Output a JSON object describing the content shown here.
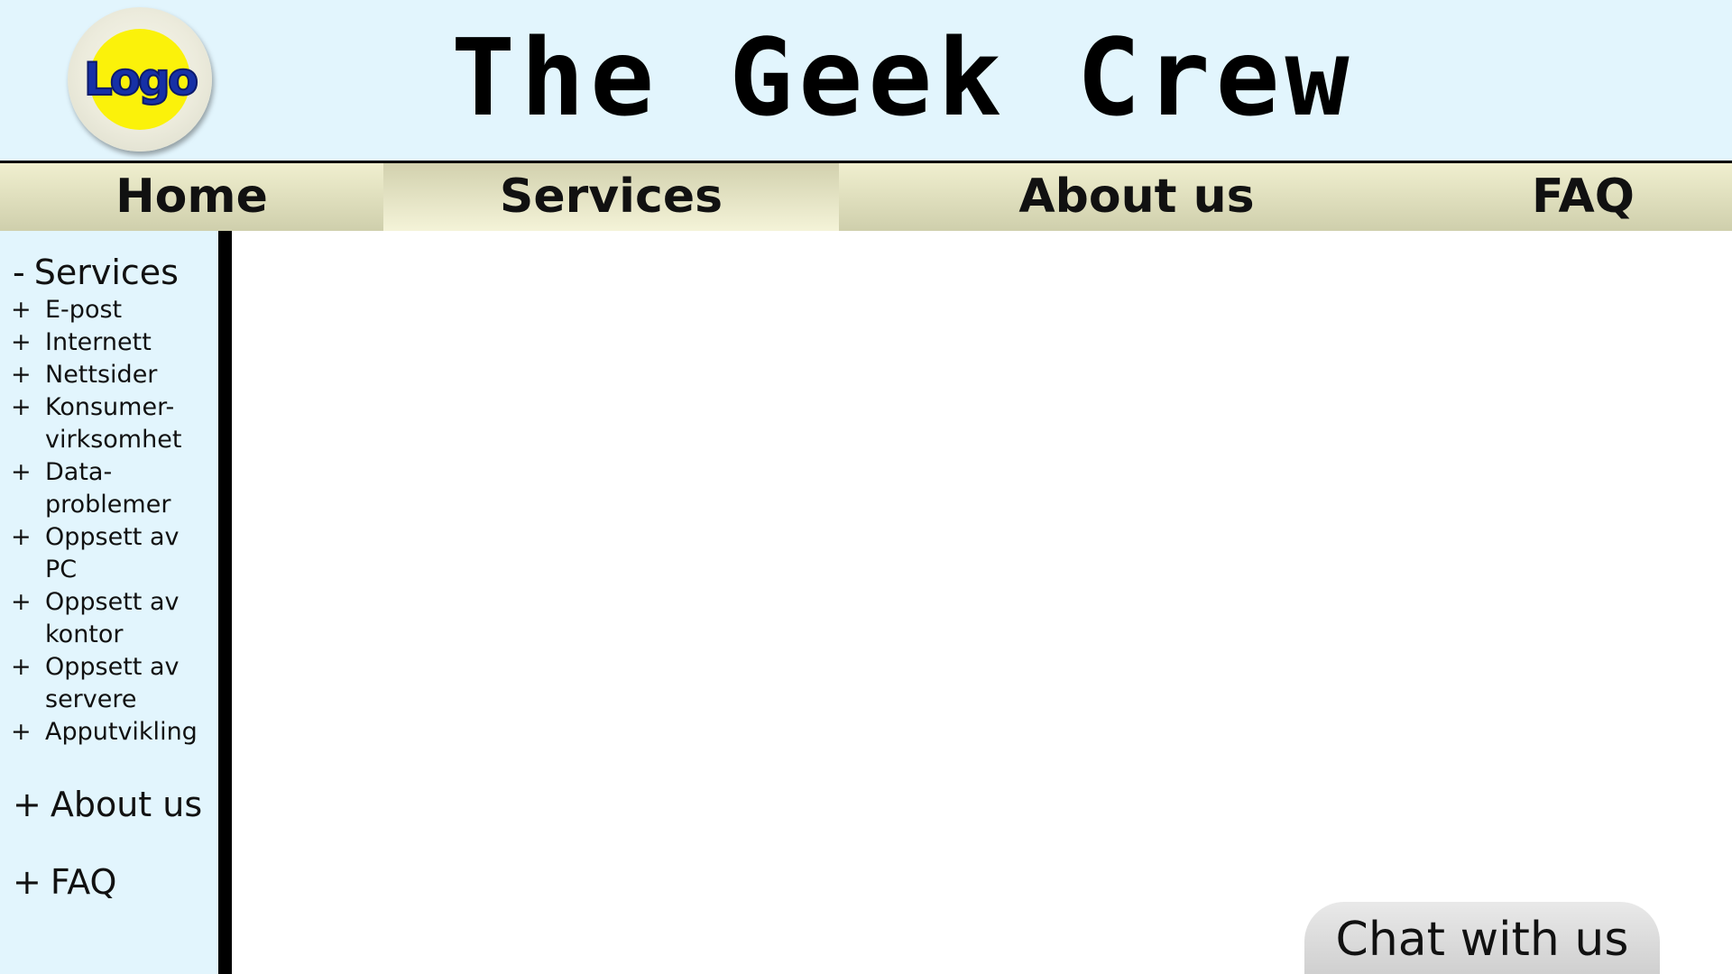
{
  "header": {
    "logo_text": "Logo",
    "site_title": "The Geek Crew"
  },
  "nav": {
    "items": [
      {
        "label": "Home"
      },
      {
        "label": "Services",
        "active": true
      },
      {
        "label": "About us"
      },
      {
        "label": "FAQ"
      }
    ]
  },
  "sidebar": {
    "services_heading": {
      "sign": "-",
      "label": "Services"
    },
    "services_items": [
      {
        "sign": "+",
        "label": "E-post"
      },
      {
        "sign": "+",
        "label": "Internett"
      },
      {
        "sign": "+",
        "label": "Nettsider"
      },
      {
        "sign": "+",
        "label": "Konsumer-\nvirksomhet"
      },
      {
        "sign": "+",
        "label": "Data-\nproblemer"
      },
      {
        "sign": "+",
        "label": "Oppsett av\nPC"
      },
      {
        "sign": "+",
        "label": "Oppsett av\nkontor"
      },
      {
        "sign": "+",
        "label": "Oppsett av\nservere"
      },
      {
        "sign": "+",
        "label": "Apputvikling"
      }
    ],
    "about_heading": {
      "sign": "+",
      "label": "About us"
    },
    "faq_heading": {
      "sign": "+",
      "label": "FAQ"
    }
  },
  "chat": {
    "label": "Chat with us"
  },
  "colors": {
    "header_bg": "#e2f5fd",
    "nav_bg": "#e2e1c0",
    "logo_yellow": "#fbf20a",
    "logo_blue": "#1630a6",
    "divider": "#000000",
    "chat_bg": "#d8d8d8"
  }
}
